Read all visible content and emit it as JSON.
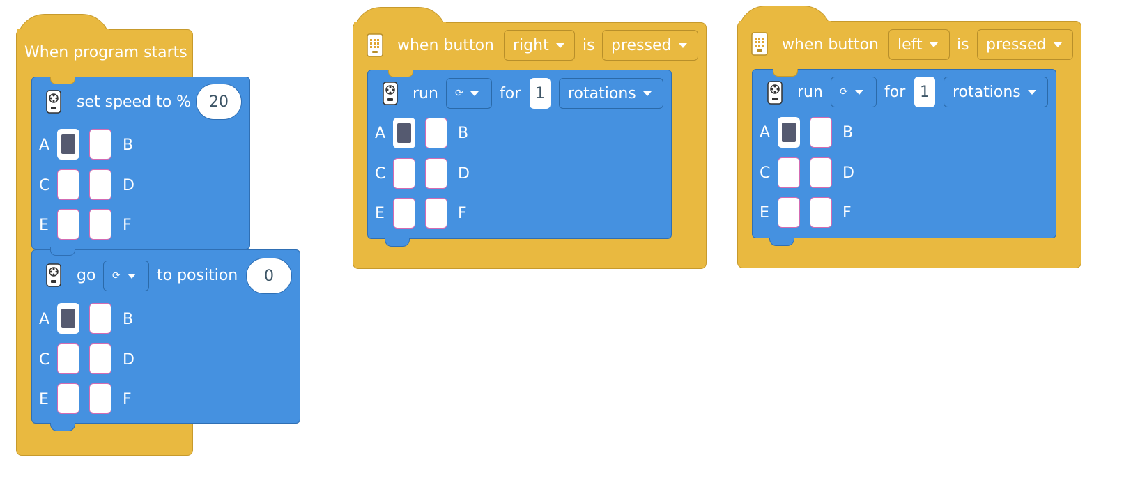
{
  "colors": {
    "event_yellow": "#e9b940",
    "motor_blue": "#4591e0",
    "port_selected": "#555a70"
  },
  "stack1": {
    "hat": {
      "label": "When program starts"
    },
    "block1": {
      "label": "set speed to %",
      "value": "20",
      "icon": "motor-icon",
      "ports": [
        {
          "left": "A",
          "right": "B"
        },
        {
          "left": "C",
          "right": "D"
        },
        {
          "left": "E",
          "right": "F"
        }
      ],
      "selected_port": "A"
    },
    "block2": {
      "label_go": "go",
      "direction_icon": "rotate-icon",
      "label_to": "to position",
      "value": "0",
      "icon": "motor-icon",
      "ports": [
        {
          "left": "A",
          "right": "B"
        },
        {
          "left": "C",
          "right": "D"
        },
        {
          "left": "E",
          "right": "F"
        }
      ],
      "selected_port": "A"
    }
  },
  "stack2": {
    "hat": {
      "icon": "hub-icon",
      "label_when": "when button",
      "button": "right",
      "label_is": "is",
      "state": "pressed"
    },
    "block": {
      "label_run": "run",
      "direction_icon": "rotate-icon",
      "label_for": "for",
      "value": "1",
      "unit": "rotations",
      "icon": "motor-icon",
      "ports": [
        {
          "left": "A",
          "right": "B"
        },
        {
          "left": "C",
          "right": "D"
        },
        {
          "left": "E",
          "right": "F"
        }
      ],
      "selected_port": "A"
    }
  },
  "stack3": {
    "hat": {
      "icon": "hub-icon",
      "label_when": "when button",
      "button": "left",
      "label_is": "is",
      "state": "pressed"
    },
    "block": {
      "label_run": "run",
      "direction_icon": "rotate-icon",
      "label_for": "for",
      "value": "1",
      "unit": "rotations",
      "icon": "motor-icon",
      "ports": [
        {
          "left": "A",
          "right": "B"
        },
        {
          "left": "C",
          "right": "D"
        },
        {
          "left": "E",
          "right": "F"
        }
      ],
      "selected_port": "A"
    }
  }
}
